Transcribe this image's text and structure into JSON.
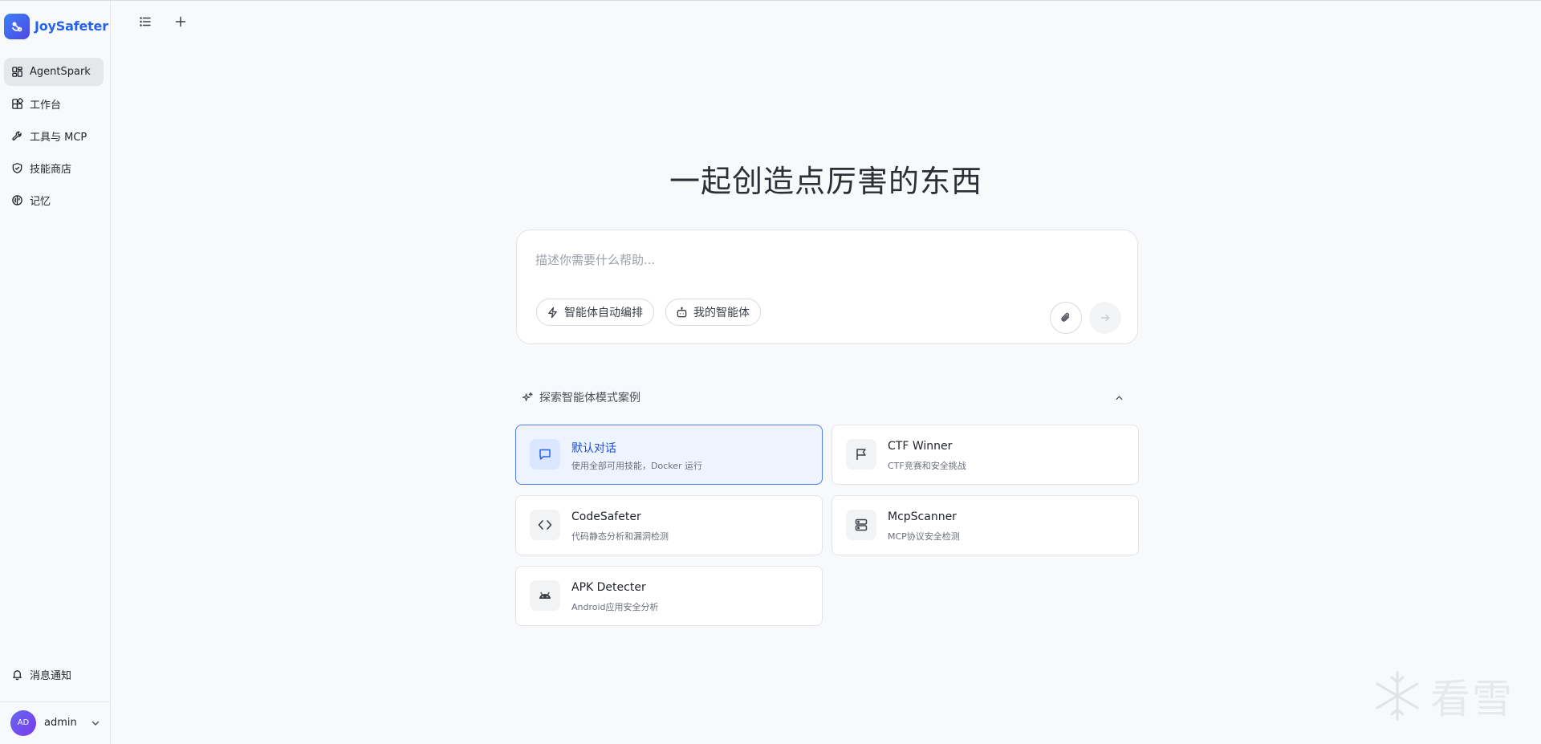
{
  "brand": {
    "name": "JoySafeter"
  },
  "sidebar": {
    "items": [
      {
        "label": "AgentSpark",
        "icon": "dashboard-icon",
        "active": true
      },
      {
        "label": "工作台",
        "icon": "workspace-icon",
        "active": false
      },
      {
        "label": "工具与 MCP",
        "icon": "wrench-icon",
        "active": false
      },
      {
        "label": "技能商店",
        "icon": "shield-check-icon",
        "active": false
      },
      {
        "label": "记忆",
        "icon": "brain-icon",
        "active": false
      }
    ],
    "notifications": {
      "label": "消息通知",
      "icon": "bell-icon"
    },
    "user": {
      "initials": "AD",
      "name": "admin"
    }
  },
  "toolbar": {
    "list_icon": "list-icon",
    "new_icon": "plus-icon"
  },
  "main": {
    "title": "一起创造点厉害的东西",
    "composer": {
      "placeholder": "描述你需要什么帮助...",
      "pill_auto": "智能体自动编排",
      "pill_mine": "我的智能体"
    },
    "explore": {
      "title": "探索智能体模式案例",
      "cards": [
        {
          "title": "默认对话",
          "desc": "使用全部可用技能，Docker 运行",
          "icon": "chat-icon",
          "selected": true
        },
        {
          "title": "CTF Winner",
          "desc": "CTF竞赛和安全挑战",
          "icon": "flag-icon",
          "selected": false
        },
        {
          "title": "CodeSafeter",
          "desc": "代码静态分析和漏洞检测",
          "icon": "code-icon",
          "selected": false
        },
        {
          "title": "McpScanner",
          "desc": "MCP协议安全检测",
          "icon": "server-icon",
          "selected": false
        },
        {
          "title": "APK Detecter",
          "desc": "Android应用安全分析",
          "icon": "android-icon",
          "selected": false
        }
      ]
    }
  },
  "watermark": {
    "text": "看雪"
  },
  "colors": {
    "accent": "#2563eb",
    "selected_border": "#4f7df2",
    "selected_bg": "#eef4ff"
  }
}
